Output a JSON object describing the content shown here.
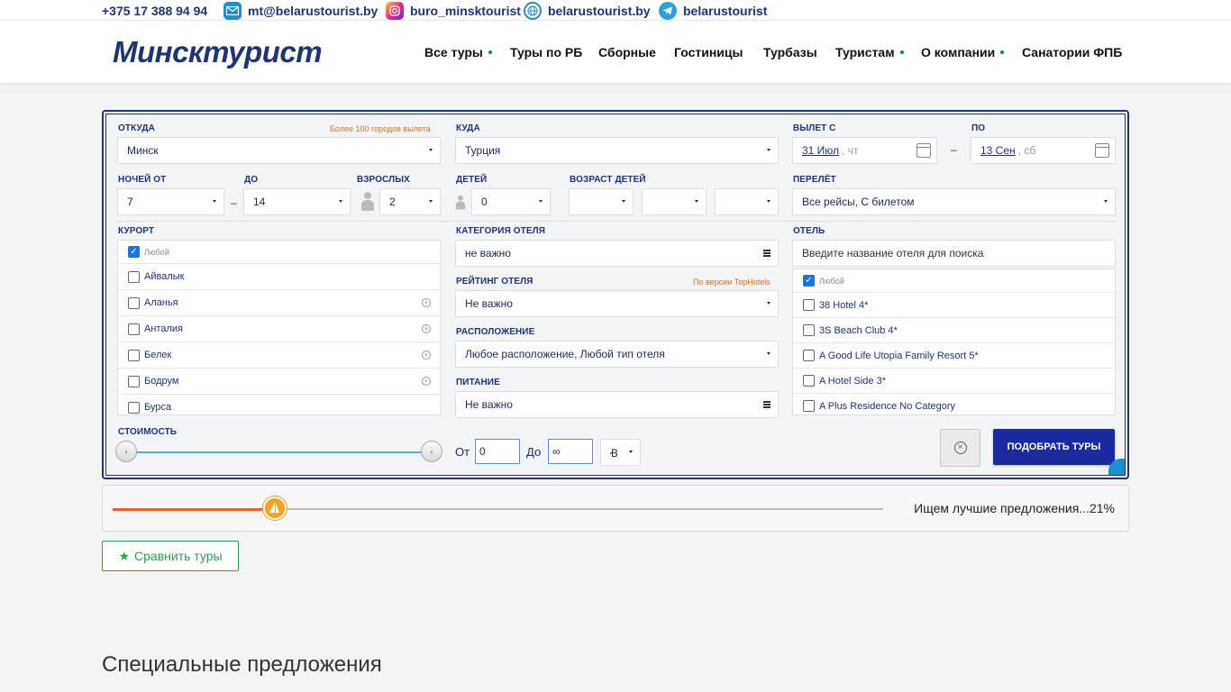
{
  "topbar": {
    "phone": "+375 17 388 94 94",
    "email": "mt@belarustourist.by",
    "instagram": "buro_minsktourist",
    "site": "belarustourist.by",
    "telegram": "belarustourist"
  },
  "header": {
    "logo_text": "Минсктурист",
    "nav": [
      "Все туры",
      "Туры по РБ",
      "Сборные",
      "Гостиницы",
      "Турбазы",
      "Туристам",
      "О компании",
      "Санатории ФПБ"
    ]
  },
  "form": {
    "from_label": "Откуда",
    "from_hint": "Более 100 городов вылета",
    "from_value": "Минск",
    "to_label": "Куда",
    "to_value": "Турция",
    "depart_label": "Вылет с",
    "depart_date": "31 Июл",
    "depart_day": ", чт",
    "until_label": "по",
    "until_date": "13 Сен",
    "until_day": ", сб",
    "date_dash": "–",
    "nights_from_label": "Ночей от",
    "nights_from": "7",
    "nights_dash": "–",
    "nights_to_label": "до",
    "nights_to": "14",
    "adults_label": "Взрослых",
    "adults": "2",
    "children_label": "Детей",
    "children": "0",
    "child_age_label": "Возраст детей",
    "flight_label": "Перелёт",
    "flight_value": "Все рейсы, С билетом",
    "resort_label": "Курорт",
    "resort_any": "Любой",
    "resorts": [
      "Айвалык",
      "Аланья",
      "Анталия",
      "Белек",
      "Бодрум",
      "Бурса"
    ],
    "category_label": "Категория отеля",
    "category_value": "не важно",
    "rating_label": "Рейтинг отеля",
    "rating_hint": "По версии TopHotels",
    "rating_value": "Не важно",
    "location_label": "Расположение",
    "location_value": "Любое расположение, Любой тип отеля",
    "meal_label": "Питание",
    "meal_value": "Не важно",
    "hotel_label": "Отель",
    "hotel_search_placeholder": "Введите название отеля для поиска",
    "hotel_any": "Любой",
    "hotels": [
      "38 Hotel 4*",
      "3S Beach Club 4*",
      "A Good Life Utopia Family Resort 5*",
      "A Hotel Side 3*",
      "A Plus Residence No Category"
    ],
    "price_label": "Стоимость",
    "price_from_label": "От",
    "price_from": "0",
    "price_to_label": "До",
    "price_to": "∞",
    "currency_symbol": "Ꞗ",
    "search_button": "Подобрать туры"
  },
  "progress": {
    "text": "Ищем лучшие предложения...21%",
    "percent": 21
  },
  "compare_button": "Сравнить туры",
  "special_title": "Специальные предложения"
}
